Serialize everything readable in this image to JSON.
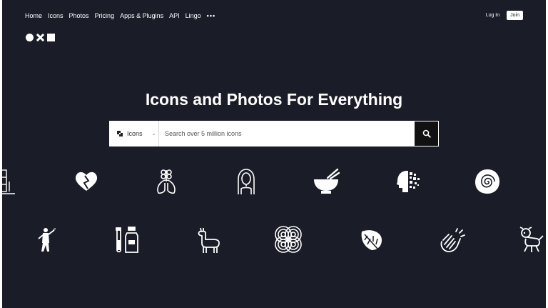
{
  "nav": {
    "items": [
      "Home",
      "Icons",
      "Photos",
      "Pricing",
      "Apps & Plugins",
      "API",
      "Lingo"
    ],
    "more_label": "•••",
    "login_label": "Log In",
    "join_label": "Join"
  },
  "logo": {
    "shapes": [
      "circle",
      "x",
      "square"
    ]
  },
  "hero": {
    "title": "Icons and Photos For Everything"
  },
  "search": {
    "type_label": "Icons",
    "type_chevron": "⌄",
    "placeholder": "Search over 5 million icons"
  },
  "icons_row1": [
    "building-icon",
    "heart-icon",
    "lungs-icon",
    "woman-icon",
    "bowl-icon",
    "digital-head-icon",
    "nautilus-icon"
  ],
  "icons_row2": [
    "ninja-icon",
    "lab-bottles-icon",
    "llama-icon",
    "knot-icon",
    "leaf-icon",
    "clapping-icon",
    "dog-icon"
  ],
  "colors": {
    "background": "#1a1c27",
    "text": "#ffffff",
    "button": "#111111"
  }
}
